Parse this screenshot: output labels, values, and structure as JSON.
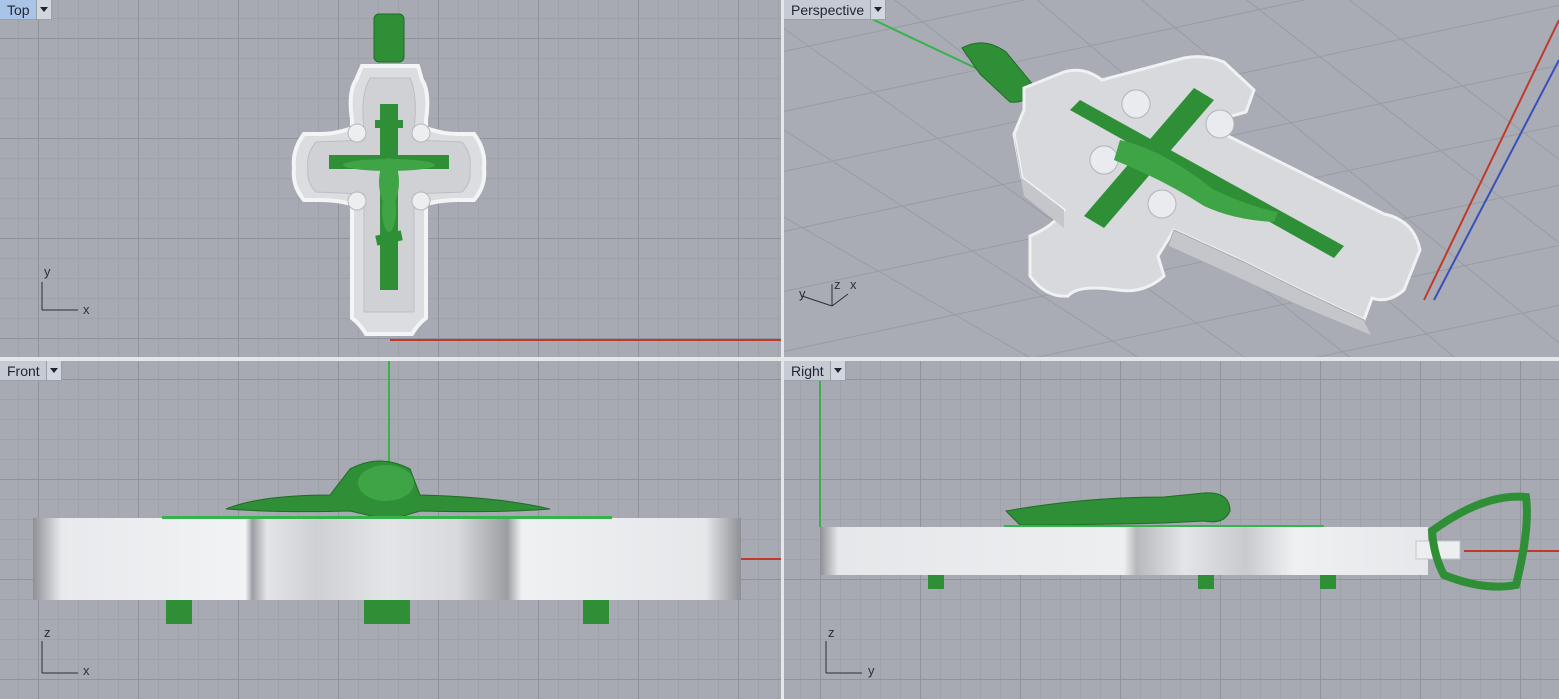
{
  "viewports": {
    "top": {
      "label": "Top",
      "active": true,
      "axis_x": "x",
      "axis_y": "y"
    },
    "perspective": {
      "label": "Perspective",
      "axis_x": "x",
      "axis_y": "y",
      "axis_z": "z"
    },
    "front": {
      "label": "Front",
      "axis_x": "x",
      "axis_z": "z"
    },
    "right": {
      "label": "Right",
      "axis_y": "y",
      "axis_z": "z"
    }
  },
  "colors": {
    "grid_bg": "#a7aab2",
    "model_body": "#e6e7ea",
    "model_green": "#2f8f36",
    "axis_x_red": "#c0392b",
    "axis_y_green": "#37b24d",
    "axis_z_blue": "#3b4fb8",
    "active_label": "#a9c4e6"
  },
  "icons": {
    "dropdown": "chevron-down-icon"
  }
}
